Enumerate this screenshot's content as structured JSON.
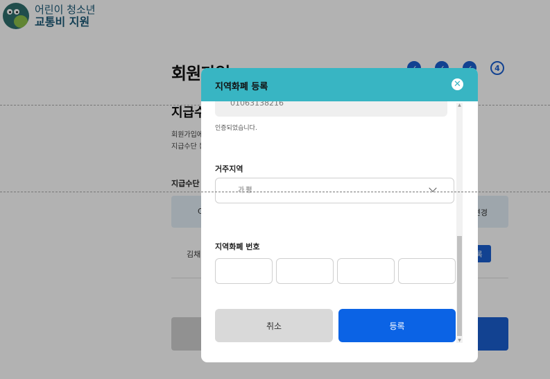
{
  "logo": {
    "line1": "어린이 청소년",
    "line2": "교통비 지원"
  },
  "page": {
    "title": "회원가입",
    "steps": [
      {
        "label": ""
      },
      {
        "label": ""
      },
      {
        "label": ""
      },
      {
        "label": "4"
      }
    ],
    "subtitle": "지급수",
    "desc_line1": "회원가입에",
    "desc_line2": "지급수단 등",
    "payment_label": "지급수단",
    "payment_left": "C",
    "payment_right": "변경",
    "name_value": "김채",
    "small_button": "록"
  },
  "modal": {
    "title": "지역화폐 등록",
    "phone_value": "01063138216",
    "verified_text": "인증되었습니다.",
    "region_label": "거주지역",
    "region_value": "가평",
    "number_label": "지역화폐 번호",
    "cancel_label": "취소",
    "submit_label": "등록"
  },
  "colors": {
    "header": "#38b5c3",
    "primary": "#0b63e5"
  }
}
